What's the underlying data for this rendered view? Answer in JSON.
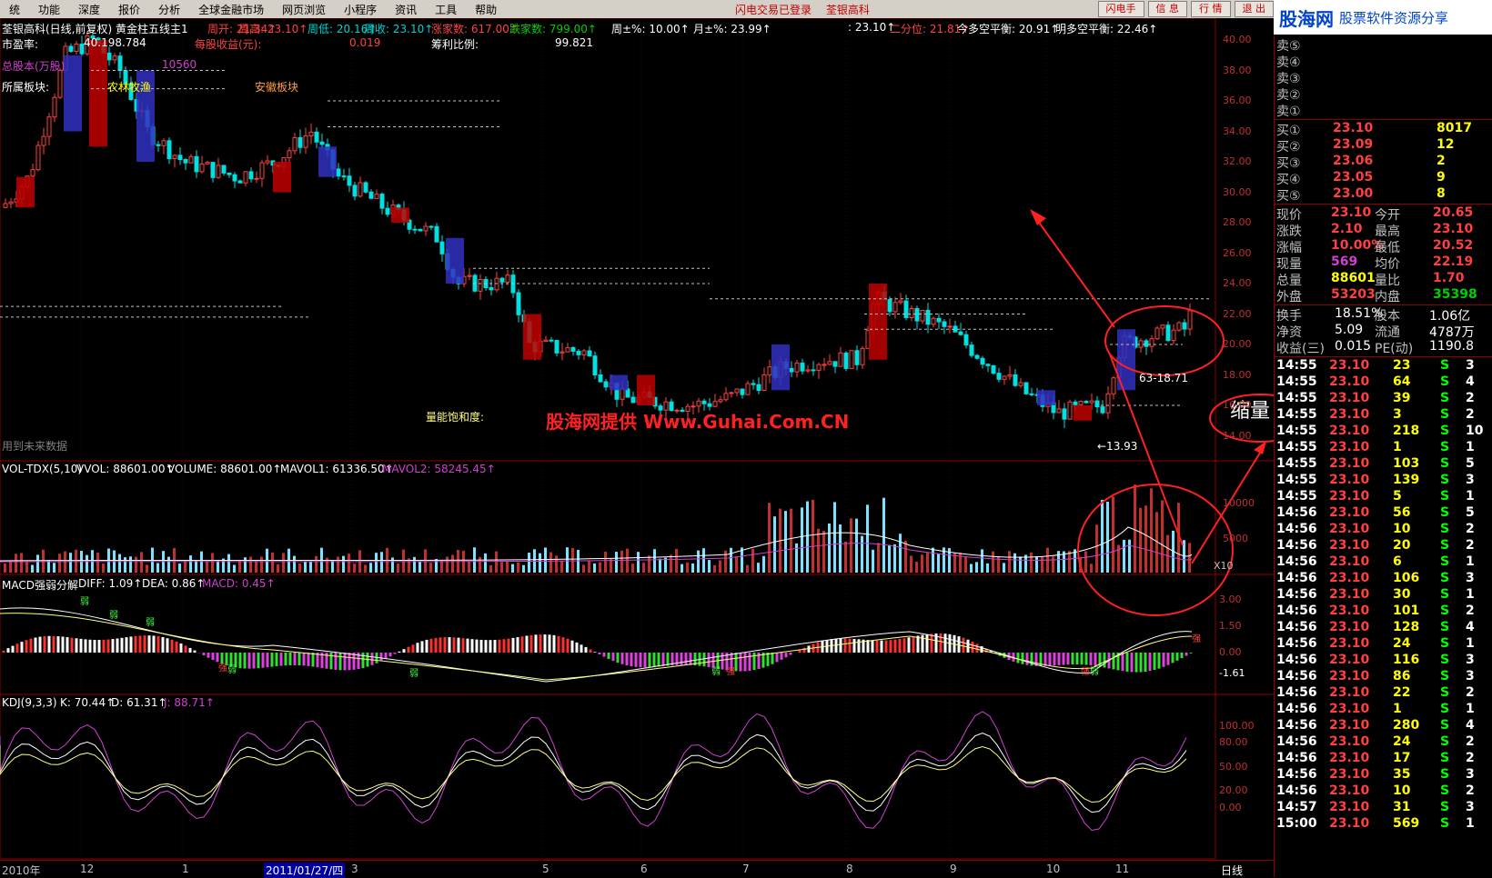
{
  "menu": {
    "items": [
      "统",
      "功能",
      "深度",
      "报价",
      "分析",
      "全球金融市场",
      "网页浏览",
      "小程序",
      "资讯",
      "工具",
      "帮助"
    ],
    "status": [
      "闪电交易已登录",
      "荃银高科"
    ],
    "buttons": [
      "闪电手",
      "信 息",
      "行 情",
      "退 出"
    ]
  },
  "logo": {
    "brand": "股海网",
    "slogan": "股票软件资源分享",
    "url": "www.Guhai.com.cn"
  },
  "main_header": {
    "title": "荃银高科(日线,前复权) 黄金柱五线主1",
    "items": [
      {
        "label": "周开: 21.34",
        "color": "#ff4040"
      },
      {
        "label": "周高: 23.10",
        "color": "#ff4040"
      },
      {
        "label": "周低: 20.16",
        "color": "#00d0d0"
      },
      {
        "label": "周收: 23.10",
        "color": "#00d0d0"
      },
      {
        "label": "涨家数: 617.00",
        "color": "#ff4040"
      },
      {
        "label": "跌家数: 799.00",
        "color": "#00d000"
      },
      {
        "label": "周±%: 10.00",
        "color": "#ffffff"
      },
      {
        "label": "月±%: 23.99",
        "color": "#ffffff"
      },
      {
        "label": ": 23.10",
        "color": "#ffffff"
      },
      {
        "label": "二分位: 21.81",
        "color": "#ff4040"
      },
      {
        "label": "今多空平衡: 20.91",
        "color": "#ffffff"
      },
      {
        "label": "明多空平衡: 22.46",
        "color": "#ffffff"
      }
    ],
    "left_labels": [
      {
        "label": "市盈率:",
        "color": "#ffffff"
      },
      {
        "label": "总股本(万股)",
        "color": "#d040d0"
      },
      {
        "label": "所属板块:",
        "color": "#ffffff"
      }
    ],
    "stats": [
      {
        "label": "40.198.784",
        "color": "#ffffff"
      },
      {
        "label": "每股收益(元):",
        "color": "#ff4040"
      },
      {
        "label": "0.019",
        "color": "#ff4040"
      },
      {
        "label": "筹利比例:",
        "color": "#ffffff"
      },
      {
        "label": "99.821",
        "color": "#ffffff"
      },
      {
        "label": "10560",
        "color": "#d040d0"
      },
      {
        "label": "农林牧渔",
        "color": "#ffff00"
      },
      {
        "label": "安徽板块",
        "color": "#ffa040"
      }
    ],
    "note": "用到未来数据",
    "saturation_label": "量能饱和度:",
    "ann_high": "63-18.71",
    "ann_low": "←13.93",
    "shrink_label": "缩量",
    "watermark": "股海网提供 Www.Guhai.Com.CN"
  },
  "y_axis_main": [
    "40.00",
    "38.00",
    "36.00",
    "34.00",
    "32.00",
    "30.00",
    "28.00",
    "26.00",
    "24.00",
    "22.00",
    "20.00",
    "18.00",
    "16.00",
    "14.00"
  ],
  "vol_header": [
    {
      "label": "VOL-TDX(5,10)",
      "color": "#ffffff"
    },
    {
      "label": "VVOL: 88601.00",
      "color": "#ffffff"
    },
    {
      "label": "VOLUME: 88601.00",
      "color": "#ffffff"
    },
    {
      "label": "MAVOL1: 61336.50",
      "color": "#ffffff"
    },
    {
      "label": "MAVOL2: 58245.45",
      "color": "#d040d0"
    }
  ],
  "vol_axis": [
    "10000",
    "5000",
    "X10"
  ],
  "macd_header": [
    {
      "label": "MACD强弱分解",
      "color": "#ffffff"
    },
    {
      "label": "DIFF: 1.09",
      "color": "#ffffff"
    },
    {
      "label": "DEA: 0.86",
      "color": "#ffffff"
    },
    {
      "label": "MACD: 0.45",
      "color": "#d040d0"
    }
  ],
  "macd_axis": [
    "3.00",
    "1.50",
    "0.00",
    "-1.61"
  ],
  "macd_tags": {
    "strong": "强",
    "weak": "弱"
  },
  "kdj_header": [
    {
      "label": "KDJ(9,3,3)",
      "color": "#ffffff"
    },
    {
      "label": "K: 70.44",
      "color": "#ffffff"
    },
    {
      "label": "D: 61.31",
      "color": "#ffffff"
    },
    {
      "label": "J: 88.71",
      "color": "#d040d0"
    }
  ],
  "kdj_axis": [
    "100.00",
    "80.00",
    "50.00",
    "20.00",
    "0.00"
  ],
  "time_axis": {
    "year": "2010年",
    "cursor_date": "2011/01/27/四",
    "months": [
      "12",
      "1",
      "2",
      "3",
      "4",
      "5",
      "6",
      "7",
      "8",
      "9",
      "10",
      "11"
    ],
    "period": "日线"
  },
  "quote": {
    "sells": [
      {
        "label": "卖⑤",
        "price": "",
        "vol": ""
      },
      {
        "label": "卖④",
        "price": "",
        "vol": ""
      },
      {
        "label": "卖③",
        "price": "",
        "vol": ""
      },
      {
        "label": "卖②",
        "price": "",
        "vol": ""
      },
      {
        "label": "卖①",
        "price": "",
        "vol": ""
      }
    ],
    "buys": [
      {
        "label": "买①",
        "price": "23.10",
        "vol": "8017"
      },
      {
        "label": "买②",
        "price": "23.09",
        "vol": "12"
      },
      {
        "label": "买③",
        "price": "23.06",
        "vol": "2"
      },
      {
        "label": "买④",
        "price": "23.05",
        "vol": "9"
      },
      {
        "label": "买⑤",
        "price": "23.00",
        "vol": "8"
      }
    ],
    "stats": [
      {
        "l1": "现价",
        "v1": "23.10",
        "c1": "#ff4040",
        "l2": "今开",
        "v2": "20.65",
        "c2": "#ff4040"
      },
      {
        "l1": "涨跌",
        "v1": "2.10",
        "c1": "#ff4040",
        "l2": "最高",
        "v2": "23.10",
        "c2": "#ff4040"
      },
      {
        "l1": "涨幅",
        "v1": "10.00%",
        "c1": "#ff4040",
        "l2": "最低",
        "v2": "20.52",
        "c2": "#ff4040"
      },
      {
        "l1": "现量",
        "v1": "569",
        "c1": "#d040d0",
        "l2": "均价",
        "v2": "22.19",
        "c2": "#ff4040"
      },
      {
        "l1": "总量",
        "v1": "88601",
        "c1": "#ffff00",
        "l2": "量比",
        "v2": "1.70",
        "c2": "#ff4040"
      },
      {
        "l1": "外盘",
        "v1": "53203",
        "c1": "#ff4040",
        "l2": "内盘",
        "v2": "35398",
        "c2": "#00d000"
      }
    ],
    "stats2": [
      {
        "l1": "换手",
        "v1": "18.51%",
        "l2": "股本",
        "v2": "1.06亿"
      },
      {
        "l1": "净资",
        "v1": "5.09",
        "l2": "流通",
        "v2": "4787万"
      },
      {
        "l1": "收益(三)",
        "v1": "0.015",
        "l2": "PE(动)",
        "v2": "1190.8"
      }
    ]
  },
  "ticks": [
    {
      "t": "14:55",
      "p": "23.10",
      "v": "23",
      "s": "S",
      "n": "3"
    },
    {
      "t": "14:55",
      "p": "23.10",
      "v": "64",
      "s": "S",
      "n": "4"
    },
    {
      "t": "14:55",
      "p": "23.10",
      "v": "39",
      "s": "S",
      "n": "2"
    },
    {
      "t": "14:55",
      "p": "23.10",
      "v": "3",
      "s": "S",
      "n": "2"
    },
    {
      "t": "14:55",
      "p": "23.10",
      "v": "218",
      "s": "S",
      "n": "10"
    },
    {
      "t": "14:55",
      "p": "23.10",
      "v": "1",
      "s": "S",
      "n": "1"
    },
    {
      "t": "14:55",
      "p": "23.10",
      "v": "103",
      "s": "S",
      "n": "5"
    },
    {
      "t": "14:55",
      "p": "23.10",
      "v": "139",
      "s": "S",
      "n": "3"
    },
    {
      "t": "14:55",
      "p": "23.10",
      "v": "5",
      "s": "S",
      "n": "1"
    },
    {
      "t": "14:56",
      "p": "23.10",
      "v": "56",
      "s": "S",
      "n": "5"
    },
    {
      "t": "14:56",
      "p": "23.10",
      "v": "10",
      "s": "S",
      "n": "2"
    },
    {
      "t": "14:56",
      "p": "23.10",
      "v": "20",
      "s": "S",
      "n": "2"
    },
    {
      "t": "14:56",
      "p": "23.10",
      "v": "6",
      "s": "S",
      "n": "1"
    },
    {
      "t": "14:56",
      "p": "23.10",
      "v": "106",
      "s": "S",
      "n": "3"
    },
    {
      "t": "14:56",
      "p": "23.10",
      "v": "30",
      "s": "S",
      "n": "1"
    },
    {
      "t": "14:56",
      "p": "23.10",
      "v": "101",
      "s": "S",
      "n": "2"
    },
    {
      "t": "14:56",
      "p": "23.10",
      "v": "128",
      "s": "S",
      "n": "4"
    },
    {
      "t": "14:56",
      "p": "23.10",
      "v": "24",
      "s": "S",
      "n": "1"
    },
    {
      "t": "14:56",
      "p": "23.10",
      "v": "116",
      "s": "S",
      "n": "3"
    },
    {
      "t": "14:56",
      "p": "23.10",
      "v": "86",
      "s": "S",
      "n": "3"
    },
    {
      "t": "14:56",
      "p": "23.10",
      "v": "22",
      "s": "S",
      "n": "2"
    },
    {
      "t": "14:56",
      "p": "23.10",
      "v": "1",
      "s": "S",
      "n": "1"
    },
    {
      "t": "14:56",
      "p": "23.10",
      "v": "280",
      "s": "S",
      "n": "4"
    },
    {
      "t": "14:56",
      "p": "23.10",
      "v": "24",
      "s": "S",
      "n": "2"
    },
    {
      "t": "14:56",
      "p": "23.10",
      "v": "17",
      "s": "S",
      "n": "2"
    },
    {
      "t": "14:56",
      "p": "23.10",
      "v": "35",
      "s": "S",
      "n": "3"
    },
    {
      "t": "14:56",
      "p": "23.10",
      "v": "10",
      "s": "S",
      "n": "2"
    },
    {
      "t": "14:57",
      "p": "23.10",
      "v": "31",
      "s": "S",
      "n": "3"
    },
    {
      "t": "15:00",
      "p": "23.10",
      "v": "569",
      "s": "S",
      "n": "1"
    }
  ]
}
